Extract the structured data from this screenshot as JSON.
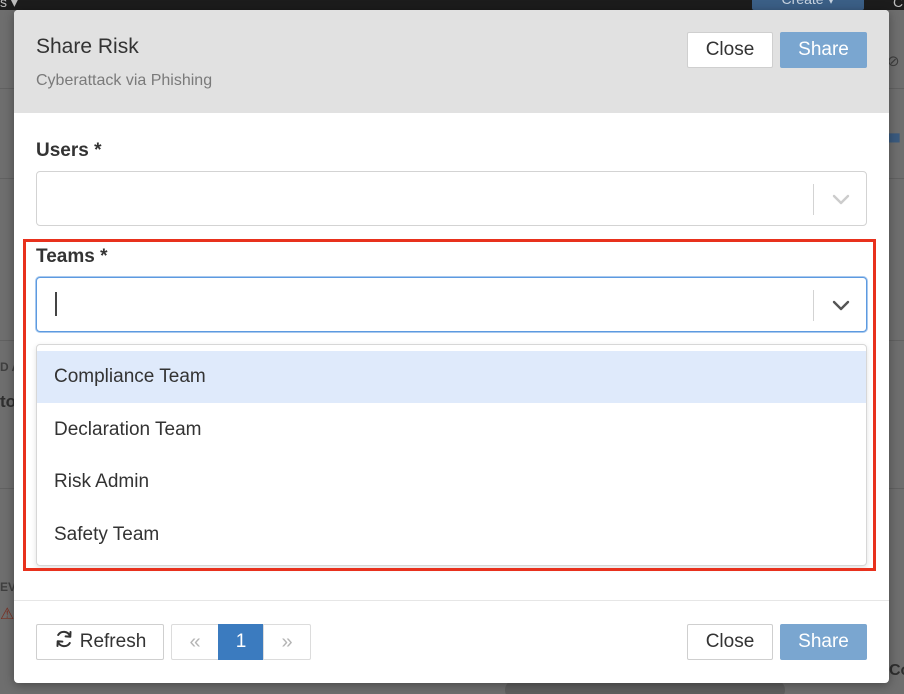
{
  "background": {
    "topbar_menu_fragment": "s ▾",
    "create_button_fragment": "Create ▾",
    "right_fragment_top": "C",
    "left_fragment_1": "D A",
    "left_fragment_2": "to",
    "left_fragment_3": "EV",
    "left_warning_icon": "warning-icon",
    "right_fragment_bottom": "Co"
  },
  "modal": {
    "title": "Share Risk",
    "subtitle": "Cyberattack via Phishing",
    "header": {
      "close_label": "Close",
      "share_label": "Share"
    },
    "users": {
      "label": "Users *",
      "value": ""
    },
    "teams": {
      "label": "Teams *",
      "value": "",
      "options": [
        "Compliance Team",
        "Declaration Team",
        "Risk Admin",
        "Safety Team"
      ],
      "highlighted_option": "Compliance Team"
    },
    "footer": {
      "refresh_label": "Refresh",
      "pager_first_icon": "double-chevron-left-icon",
      "current_page": "1",
      "pager_last_icon": "double-chevron-right-icon",
      "close_label": "Close",
      "share_label": "Share"
    }
  },
  "colors": {
    "primary_button": "#7aa6d0",
    "pager_active": "#3b7bbf",
    "highlight_border": "#e8311d",
    "option_hover": "#dfeafb",
    "focus_border": "#5c9ae0"
  }
}
